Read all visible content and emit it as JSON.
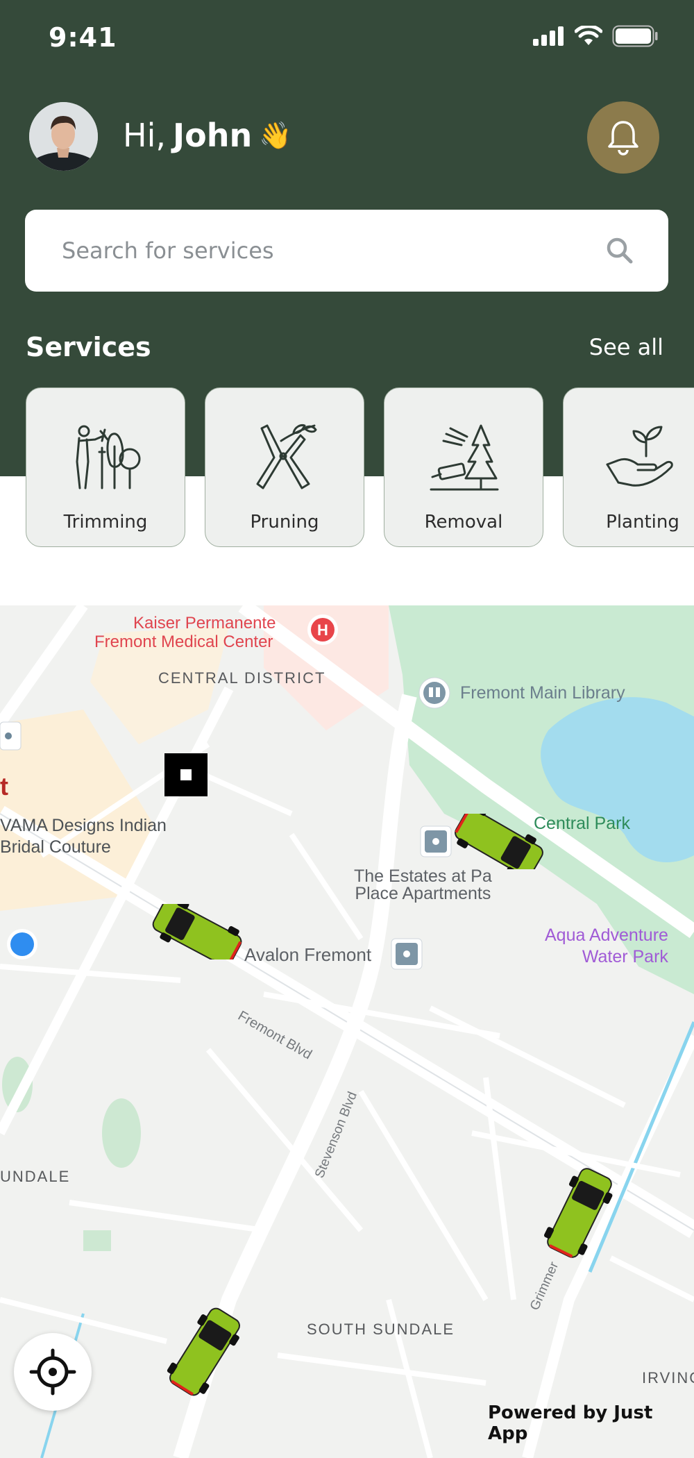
{
  "status_bar": {
    "time": "9:41"
  },
  "greeting": {
    "prefix": "Hi,",
    "name": "John",
    "emoji": "👋"
  },
  "search": {
    "placeholder": "Search for services",
    "value": ""
  },
  "services": {
    "title": "Services",
    "see_all": "See all",
    "items": [
      {
        "label": "Trimming",
        "icon": "trimming-icon"
      },
      {
        "label": "Pruning",
        "icon": "pruning-icon"
      },
      {
        "label": "Removal",
        "icon": "removal-icon"
      },
      {
        "label": "Planting",
        "icon": "planting-icon"
      }
    ]
  },
  "map": {
    "labels": {
      "kaiser1": "Kaiser Permanente",
      "kaiser2": "Fremont Medical Center",
      "central_district": "CENTRAL DISTRICT",
      "library": "Fremont Main Library",
      "central_park": "Central Park",
      "vama1": "VAMA Designs Indian",
      "vama2": "Bridal Couture",
      "t_fragment": "t",
      "estates1": "The Estates at Pa",
      "estates2": "Place Apartments",
      "aqua1": "Aqua Adventure",
      "aqua2": "Water Park",
      "avalon": "Avalon Fremont",
      "fremont_blvd": "Fremont Blvd",
      "stevenson_blvd": "Stevenson Blvd",
      "sundale": "UNDALE",
      "south_sundale": "SOUTH SUNDALE",
      "grimmer": "Grimmer",
      "irving": "IRVING"
    },
    "vehicles": [
      "truck-icon",
      "truck-icon",
      "truck-icon",
      "truck-icon"
    ]
  },
  "footer": {
    "powered_by": "Powered by Just App"
  },
  "colors": {
    "header": "#354a3a",
    "bell": "#8c7b4c",
    "truck": "#8fc21f",
    "park": "#c6e8d0",
    "water": "#9dd9ec"
  }
}
